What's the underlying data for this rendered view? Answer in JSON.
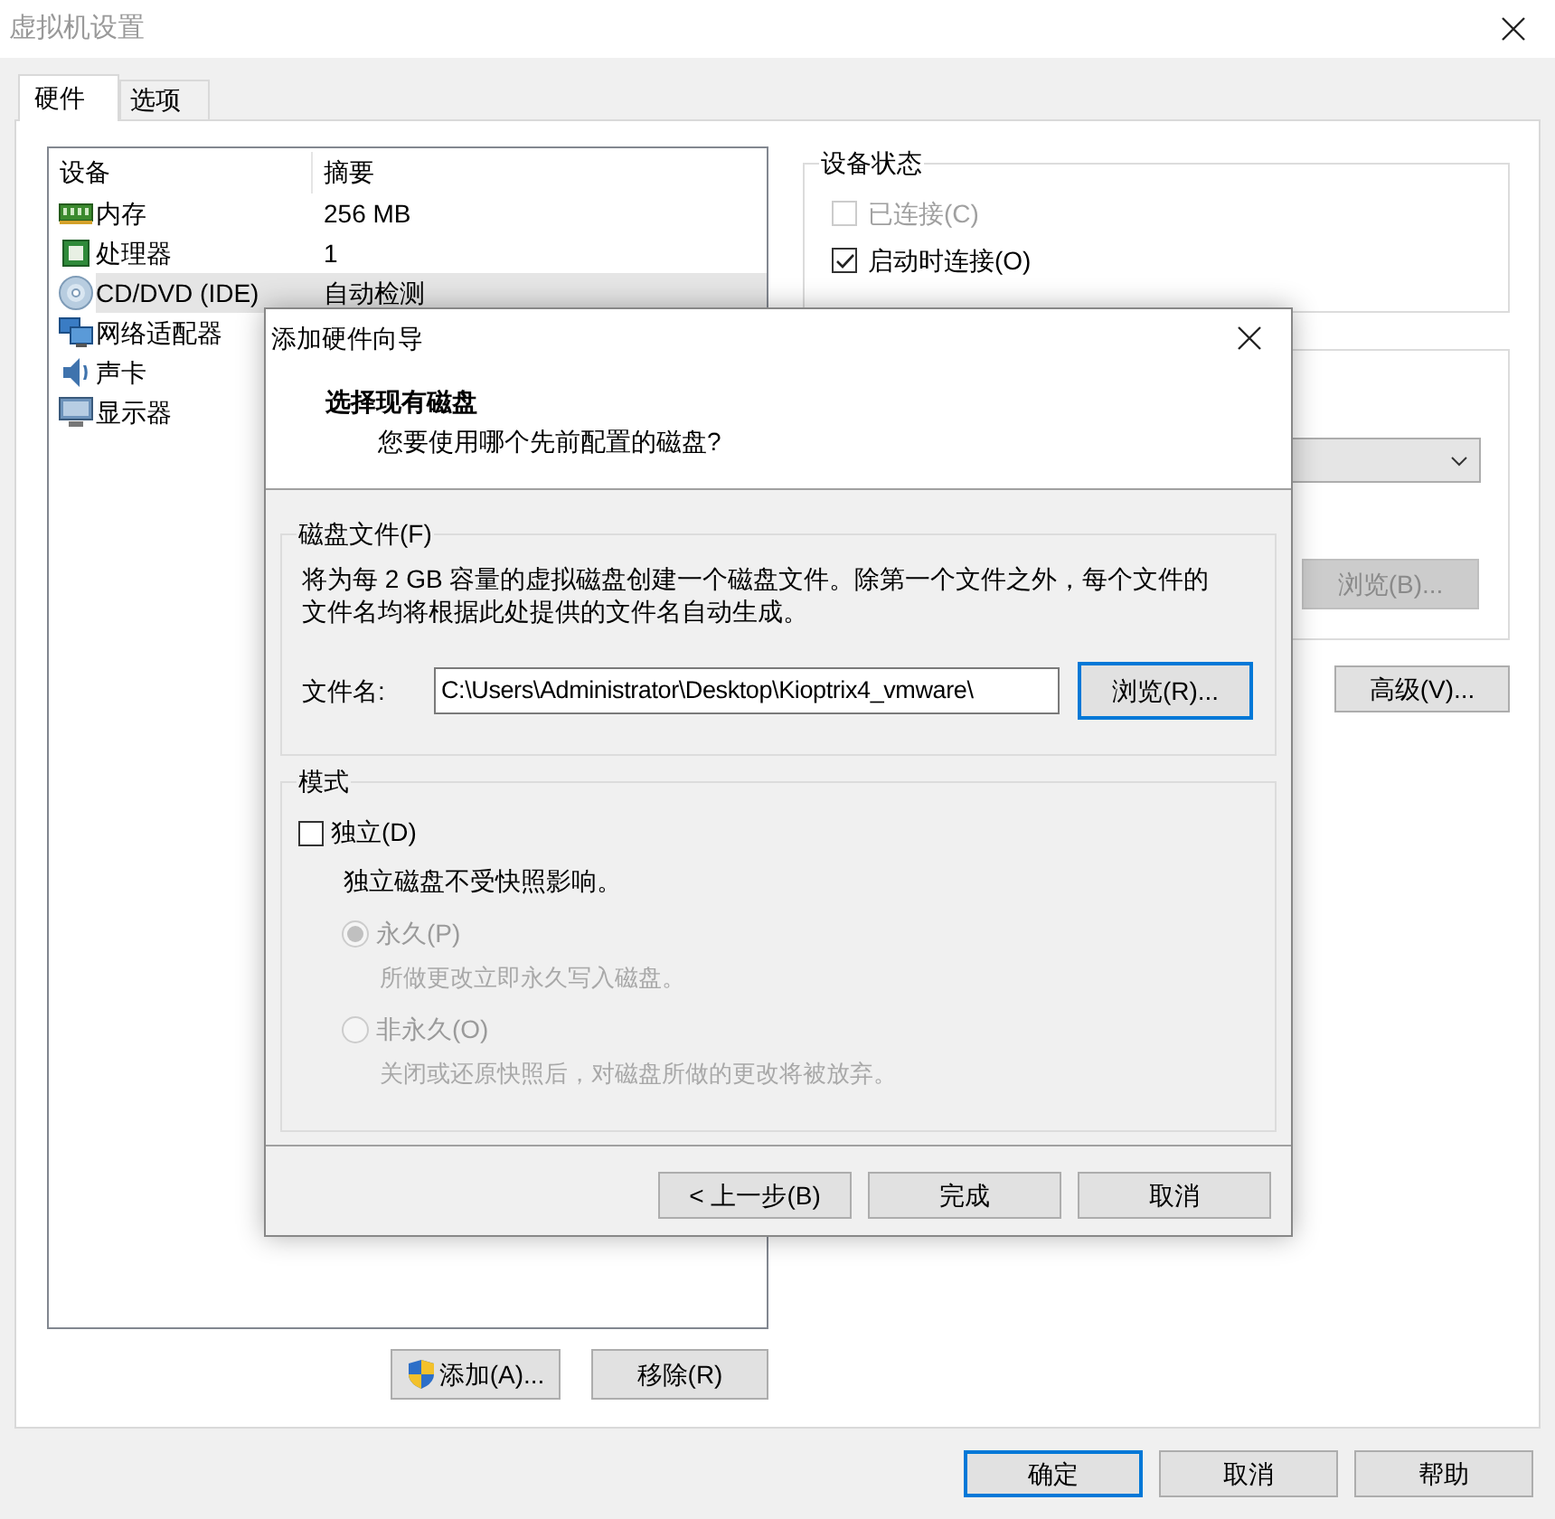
{
  "window": {
    "title": "虚拟机设置"
  },
  "tabs": [
    {
      "label": "硬件",
      "selected": true
    },
    {
      "label": "选项",
      "selected": false
    }
  ],
  "device_table": {
    "columns": [
      "设备",
      "摘要"
    ],
    "rows": [
      {
        "kind": "memory",
        "device": "内存",
        "summary": "256 MB",
        "selected": false
      },
      {
        "kind": "cpu",
        "device": "处理器",
        "summary": "1",
        "selected": false
      },
      {
        "kind": "cd",
        "device": "CD/DVD (IDE)",
        "summary": "自动检测",
        "selected": true
      },
      {
        "kind": "network",
        "device": "网络适配器",
        "summary": "",
        "selected": false
      },
      {
        "kind": "sound",
        "device": "声卡",
        "summary": "",
        "selected": false
      },
      {
        "kind": "display",
        "device": "显示器",
        "summary": "",
        "selected": false
      }
    ]
  },
  "device_status": {
    "title": "设备状态",
    "options": [
      {
        "label": "已连接(C)",
        "checked": false,
        "disabled": true
      },
      {
        "label": "启动时连接(O)",
        "checked": true,
        "disabled": false
      }
    ]
  },
  "connection": {
    "browse_button": {
      "label": "浏览(B)...",
      "disabled": true
    }
  },
  "advanced_button": {
    "label": "高级(V)..."
  },
  "list_buttons": [
    {
      "kind": "shield",
      "label": "添加(A)..."
    },
    {
      "kind": "plain",
      "label": "移除(R)"
    }
  ],
  "footer_buttons": [
    {
      "label": "确定",
      "default": true
    },
    {
      "label": "取消",
      "default": false
    },
    {
      "label": "帮助",
      "default": false
    }
  ],
  "wizard": {
    "title": "添加硬件向导",
    "heading": "选择现有磁盘",
    "subheading": "您要使用哪个先前配置的磁盘?",
    "disk_file": {
      "title": "磁盘文件(F)",
      "description": "将为每 2 GB 容量的虚拟磁盘创建一个磁盘文件。除第一个文件之外，每个文件的文件名均将根据此处提供的文件名自动生成。",
      "filename_label": "文件名:",
      "filename_value": "C:\\Users\\Administrator\\Desktop\\Kioptrix4_vmware\\",
      "browse_button": "浏览(R)..."
    },
    "mode": {
      "title": "模式",
      "independent": {
        "label": "独立(D)",
        "checked": false
      },
      "independent_note": "独立磁盘不受快照影响。",
      "options": [
        {
          "label": "永久(P)",
          "note": "所做更改立即永久写入磁盘。",
          "selected": true,
          "disabled": true
        },
        {
          "label": "非永久(O)",
          "note": "关闭或还原快照后，对磁盘所做的更改将被放弃。",
          "selected": false,
          "disabled": true
        }
      ]
    },
    "buttons": [
      {
        "label": "< 上一步(B)",
        "default": false
      },
      {
        "label": "完成",
        "default": false
      },
      {
        "label": "取消",
        "default": false
      }
    ]
  }
}
